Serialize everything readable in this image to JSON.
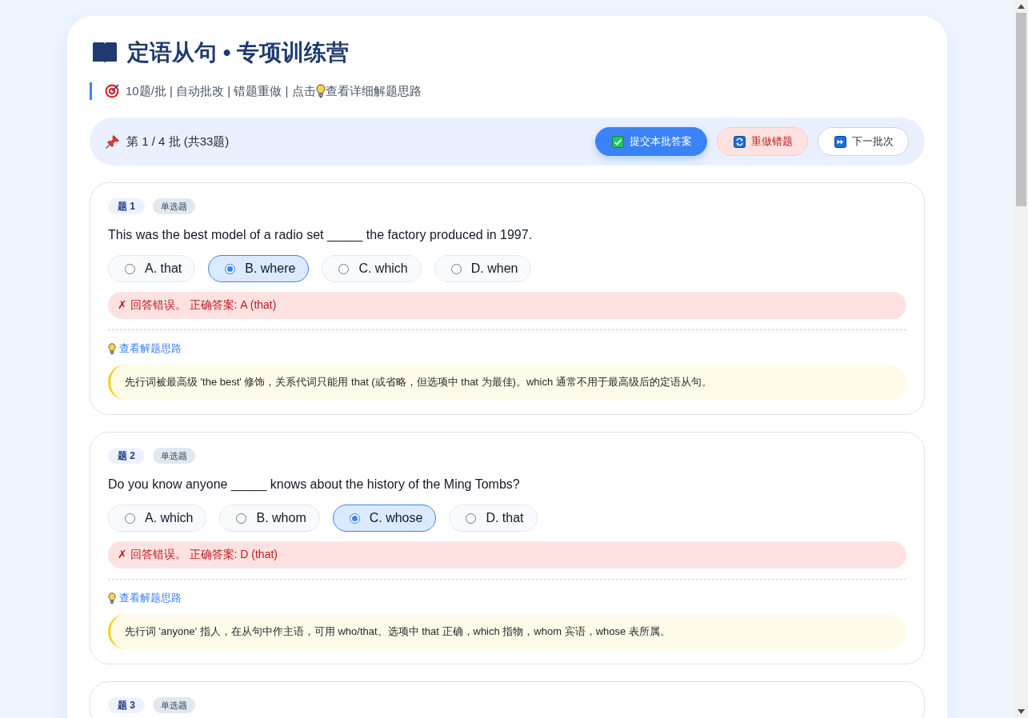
{
  "header": {
    "title": "定语从句 • 专项训练营",
    "subtitle": {
      "before_icon": "10题/批 | 自动批改 | 错题重做 | 点击",
      "after_icon": "查看详细解题思路"
    }
  },
  "toolbar": {
    "batch": "第 1 / 4 批 (共33题)",
    "buttons": [
      {
        "kind": "submit",
        "label": "提交本批答案"
      },
      {
        "kind": "redo",
        "label": "重做错题"
      },
      {
        "kind": "next",
        "label": "下一批次"
      }
    ]
  },
  "questions": [
    {
      "number": "题 1",
      "type": "单选题",
      "text": "This was the best model of a radio set _____ the factory produced in 1997.",
      "options": [
        {
          "label": "A. that",
          "selected": false
        },
        {
          "label": "B. where",
          "selected": true
        },
        {
          "label": "C. which",
          "selected": false
        },
        {
          "label": "D. when",
          "selected": false
        }
      ],
      "feedback": {
        "kind": "wrong",
        "text": "✗ 回答错误。 正确答案: A (that)"
      },
      "hint": {
        "label": "查看解题思路",
        "explanation": "先行词被最高级 'the best' 修饰，关系代词只能用 that (或省略，但选项中 that 为最佳)。which 通常不用于最高级后的定语从句。"
      }
    },
    {
      "number": "题 2",
      "type": "单选题",
      "text": "Do you know anyone _____ knows about the history of the Ming Tombs?",
      "options": [
        {
          "label": "A. which",
          "selected": false
        },
        {
          "label": "B. whom",
          "selected": false
        },
        {
          "label": "C. whose",
          "selected": true
        },
        {
          "label": "D. that",
          "selected": false
        }
      ],
      "feedback": {
        "kind": "wrong",
        "text": "✗ 回答错误。 正确答案: D (that)"
      },
      "hint": {
        "label": "查看解题思路",
        "explanation": "先行词 'anyone' 指人，在从句中作主语，可用 who/that。选项中 that 正确，which 指物，whom 宾语，whose 表所属。"
      }
    },
    {
      "number": "题 3",
      "type": "单选题"
    }
  ]
}
